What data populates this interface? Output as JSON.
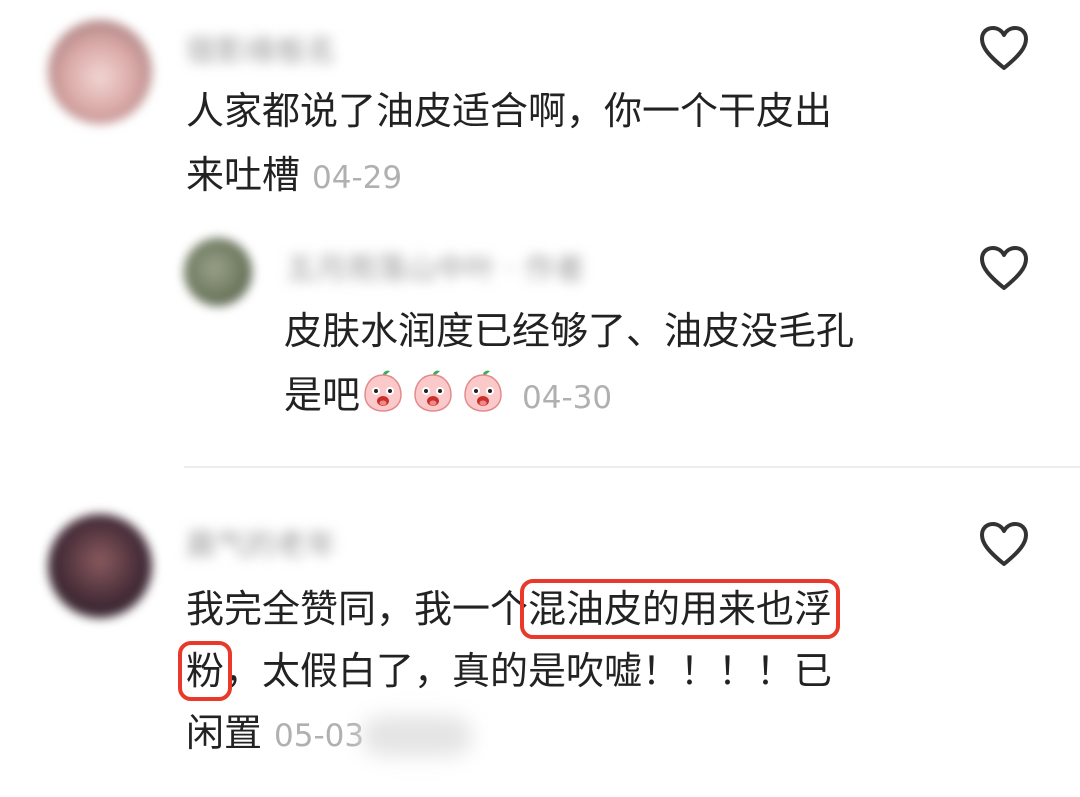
{
  "comments": [
    {
      "name": "宿影缘板名",
      "text_lines": [
        "人家都说了油皮适合啊，你一个干皮出",
        "来吐槽"
      ],
      "time": "04-29",
      "colors": {
        "avatar": "#c79a9a"
      }
    },
    {
      "name": "五月雨落山中叶 · 作者",
      "text_lines": [
        "皮肤水润度已经够了、油皮没毛孔",
        "是吧"
      ],
      "emoji": [
        "peach-emoji",
        "peach-emoji",
        "peach-emoji"
      ],
      "time": "04-30",
      "colors": {
        "avatar": "#6f7a60"
      }
    },
    {
      "name": "晨气的老年",
      "text_lines": [
        "我完全赞同，我一个",
        "混油皮的用来也浮",
        "粉",
        "，太假白了，真的是吹嘘！！！！已",
        "闲置"
      ],
      "time": "05-03",
      "colors": {
        "avatar": "#3c2a36",
        "highlight": "#e8392a"
      }
    }
  ],
  "icons": {
    "like": "heart-outline-icon"
  }
}
